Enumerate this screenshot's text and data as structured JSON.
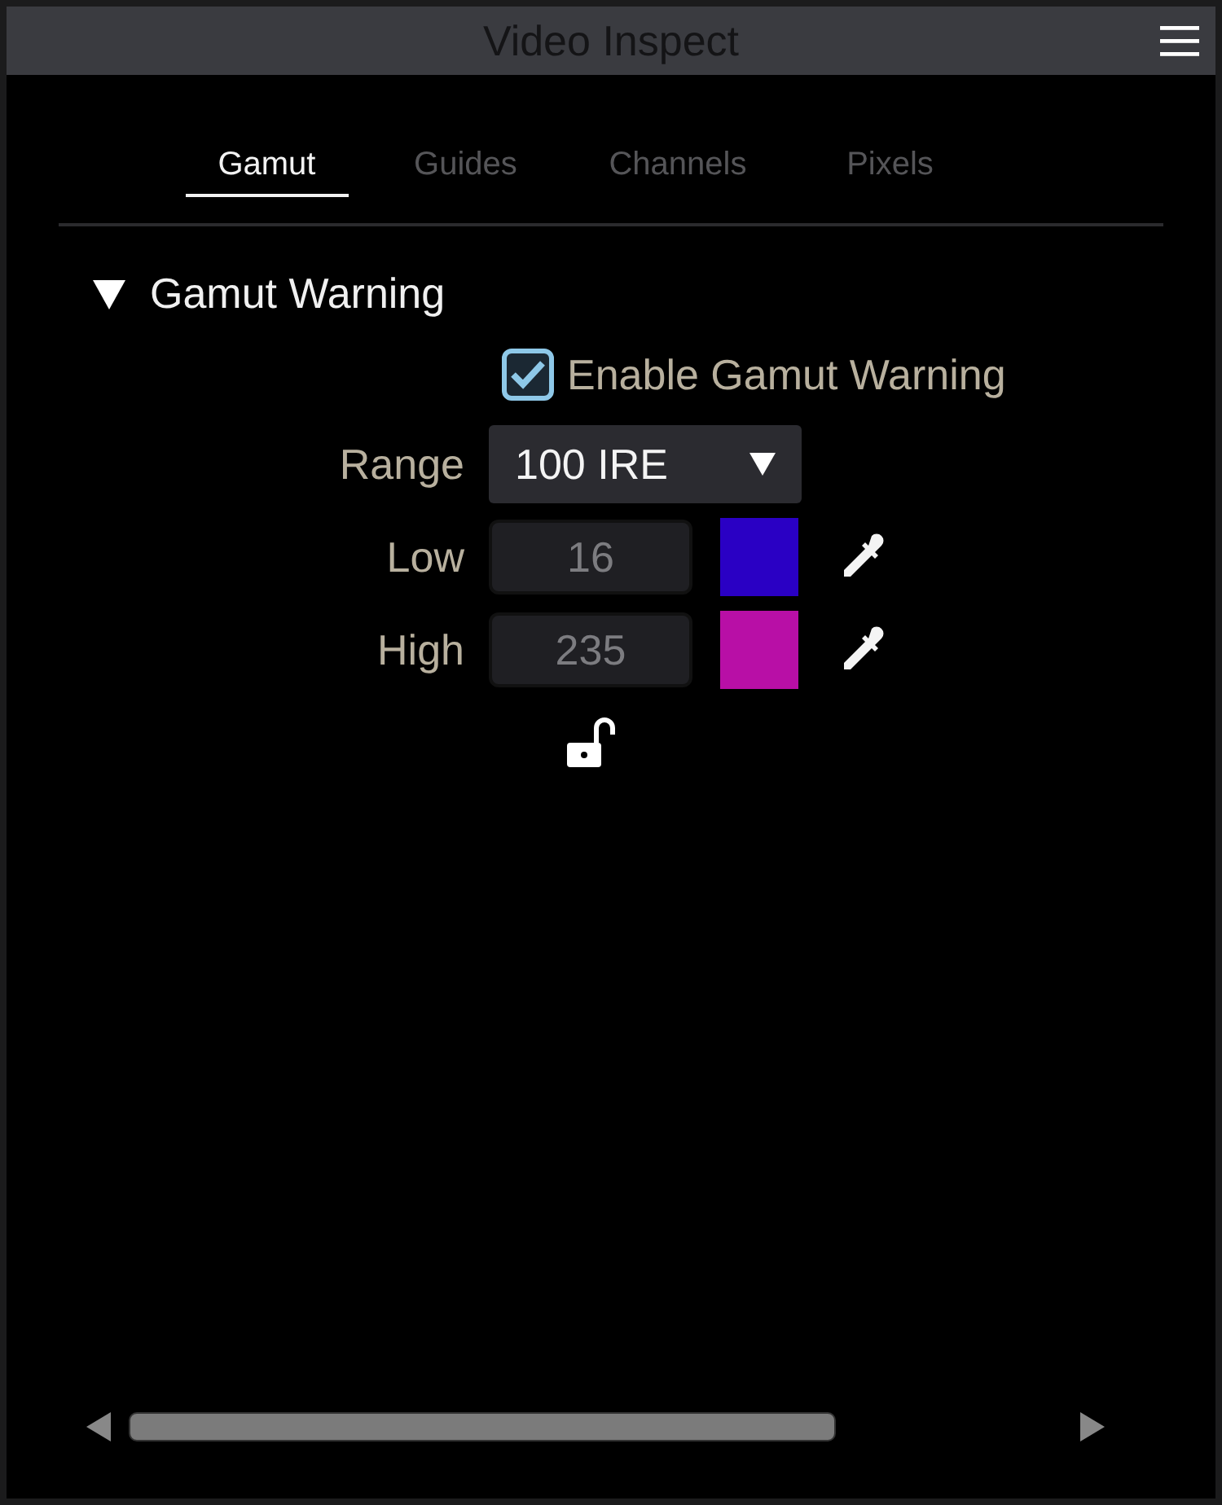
{
  "window": {
    "title": "Video Inspect"
  },
  "tabs": [
    {
      "label": "Gamut",
      "selected": true
    },
    {
      "label": "Guides",
      "selected": false
    },
    {
      "label": "Channels",
      "selected": false
    },
    {
      "label": "Pixels",
      "selected": false
    }
  ],
  "section": {
    "title": "Gamut Warning",
    "expanded": true
  },
  "enable": {
    "label": "Enable Gamut Warning",
    "checked": true
  },
  "range": {
    "label": "Range",
    "value": "100 IRE"
  },
  "thresholds": [
    {
      "label": "Low",
      "value": "16",
      "color": "#2a00c4"
    },
    {
      "label": "High",
      "value": "235",
      "color": "#b80fa6"
    }
  ],
  "lock": {
    "locked": false
  }
}
